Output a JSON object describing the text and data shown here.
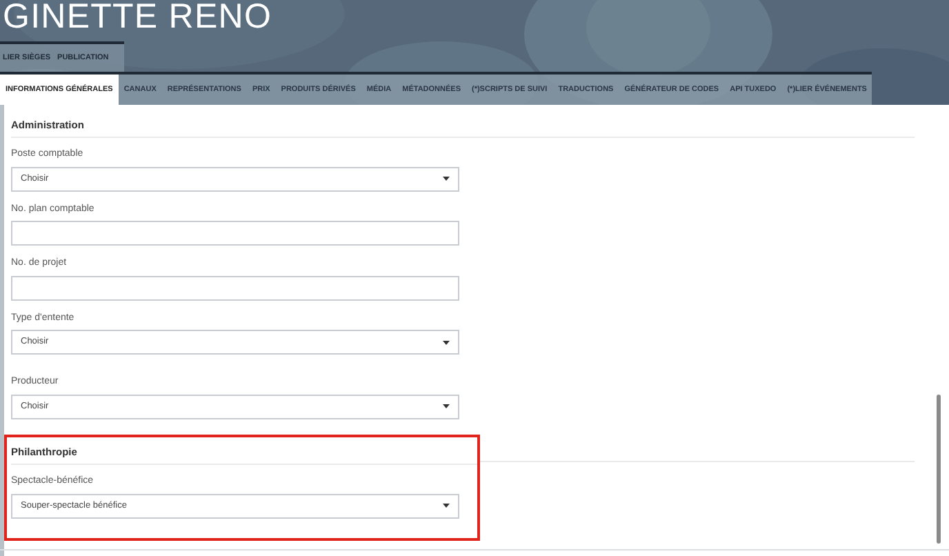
{
  "header": {
    "title": "GINETTE RENO"
  },
  "top_tabs": [
    {
      "label": "LIER SIÈGES",
      "selected": false
    },
    {
      "label": "PUBLICATION",
      "selected": false
    }
  ],
  "tabs": [
    {
      "label": "INFORMATIONS GÉNÉRALES",
      "selected": true
    },
    {
      "label": "CANAUX",
      "selected": false
    },
    {
      "label": "REPRÉSENTATIONS",
      "selected": false
    },
    {
      "label": "PRIX",
      "selected": false
    },
    {
      "label": "PRODUITS DÉRIVÉS",
      "selected": false
    },
    {
      "label": "MÉDIA",
      "selected": false
    },
    {
      "label": "MÉTADONNÉES",
      "selected": false
    },
    {
      "label": "(*)SCRIPTS DE SUIVI",
      "selected": false
    },
    {
      "label": "TRADUCTIONS",
      "selected": false
    },
    {
      "label": "GÉNÉRATEUR DE CODES",
      "selected": false
    },
    {
      "label": "API TUXEDO",
      "selected": false
    },
    {
      "label": "(*)LIER ÉVÉNEMENTS",
      "selected": false
    }
  ],
  "sections": [
    {
      "title": "Administration",
      "highlighted": false,
      "fields": [
        {
          "kind": "select",
          "label": "Poste comptable",
          "value": "Choisir"
        },
        {
          "kind": "text",
          "label": "No. plan comptable"
        },
        {
          "kind": "text",
          "label": "No. de projet"
        },
        {
          "kind": "select",
          "label": "Type d'entente",
          "value": "Choisir"
        },
        {
          "kind": "select",
          "label": "Producteur",
          "value": "Choisir"
        }
      ]
    },
    {
      "title": "Philanthropie",
      "highlighted": true,
      "fields": [
        {
          "kind": "select",
          "label": "Spectacle-bénéfice",
          "value": "Souper-spectacle bénéfice"
        }
      ]
    }
  ]
}
